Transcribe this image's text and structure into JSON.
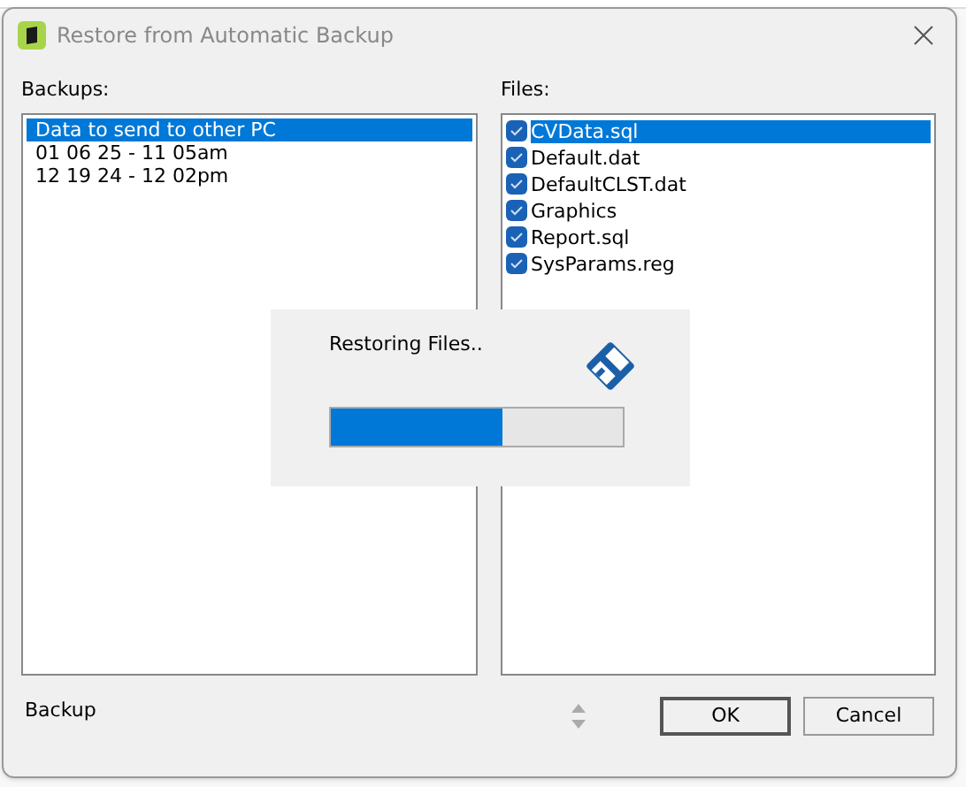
{
  "window": {
    "title": "Restore from Automatic Backup"
  },
  "backups": {
    "label": "Backups:",
    "items": [
      {
        "text": "Data to send to other PC",
        "selected": true
      },
      {
        "text": "01 06 25 - 11 05am",
        "selected": false
      },
      {
        "text": "12 19 24 - 12 02pm",
        "selected": false
      }
    ]
  },
  "files": {
    "label": "Files:",
    "items": [
      {
        "text": "CVData.sql",
        "checked": true,
        "selected": true
      },
      {
        "text": "Default.dat",
        "checked": true,
        "selected": false
      },
      {
        "text": "DefaultCLST.dat",
        "checked": true,
        "selected": false
      },
      {
        "text": "Graphics",
        "checked": true,
        "selected": false
      },
      {
        "text": "Report.sql",
        "checked": true,
        "selected": false
      },
      {
        "text": "SysParams.reg",
        "checked": true,
        "selected": false
      }
    ]
  },
  "progress": {
    "message": "Restoring Files..",
    "level": 0.59
  },
  "status": "Backup",
  "buttons": [
    {
      "label": "OK",
      "default": true
    },
    {
      "label": "Cancel",
      "default": false
    }
  ]
}
